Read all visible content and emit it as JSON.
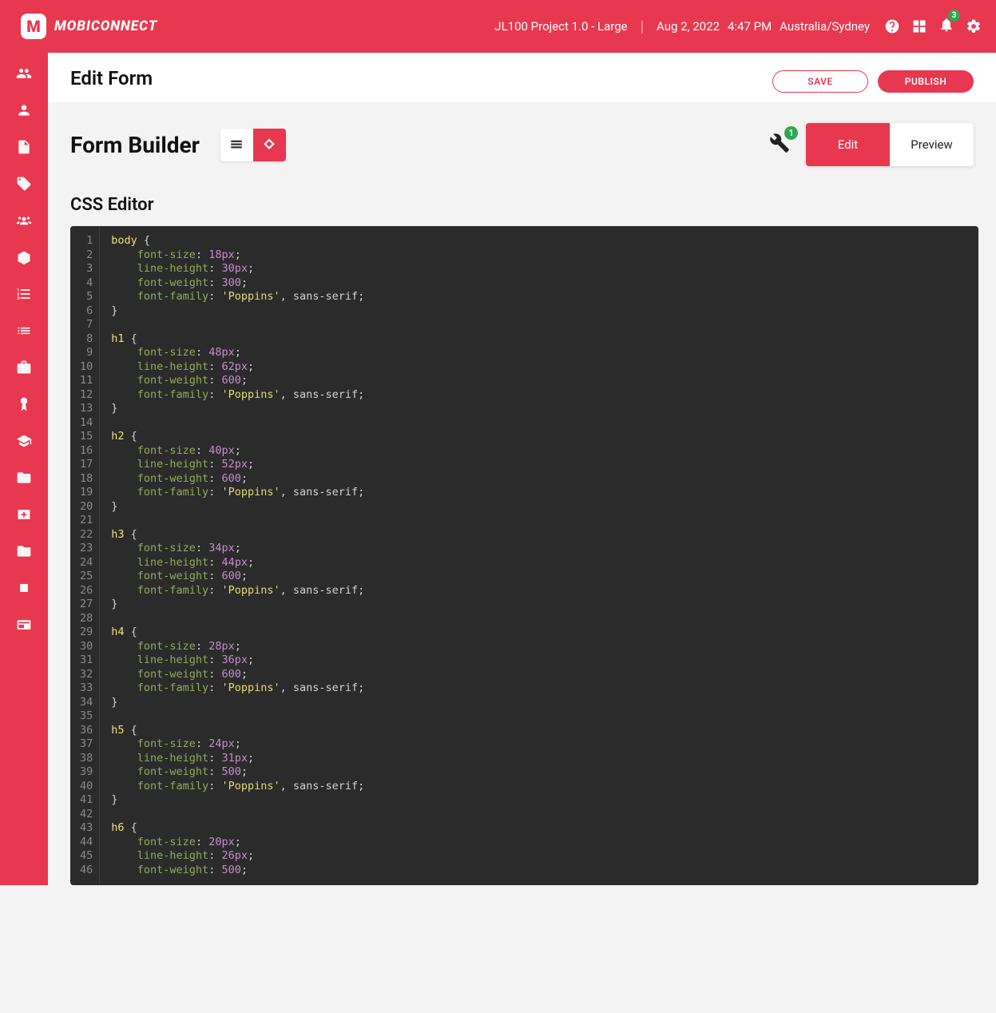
{
  "brand": "MOBICONNECT",
  "header": {
    "project": "JL100 Project 1.0 - Large",
    "date": "Aug 2, 2022",
    "time": "4:47 PM",
    "tz": "Australia/Sydney",
    "notif_count": "3"
  },
  "page": {
    "title": "Edit Form",
    "save": "SAVE",
    "publish": "PUBLISH"
  },
  "builder": {
    "title": "Form Builder",
    "wrench_badge": "1",
    "tab_edit": "Edit",
    "tab_preview": "Preview"
  },
  "css_section": {
    "title": "CSS Editor"
  },
  "code": {
    "lines": [
      [
        [
          "sel",
          "body "
        ],
        [
          "punc",
          "{"
        ]
      ],
      [
        [
          "indent",
          "    "
        ],
        [
          "prop",
          "font-size"
        ],
        [
          "punc",
          ": "
        ],
        [
          "num",
          "18px"
        ],
        [
          "punc",
          ";"
        ]
      ],
      [
        [
          "indent",
          "    "
        ],
        [
          "prop",
          "line-height"
        ],
        [
          "punc",
          ": "
        ],
        [
          "num",
          "30px"
        ],
        [
          "punc",
          ";"
        ]
      ],
      [
        [
          "indent",
          "    "
        ],
        [
          "prop",
          "font-weight"
        ],
        [
          "punc",
          ": "
        ],
        [
          "num",
          "300"
        ],
        [
          "punc",
          ";"
        ]
      ],
      [
        [
          "indent",
          "    "
        ],
        [
          "prop",
          "font-family"
        ],
        [
          "punc",
          ": "
        ],
        [
          "str",
          "'Poppins'"
        ],
        [
          "id",
          ", sans-serif"
        ],
        [
          "punc",
          ";"
        ]
      ],
      [
        [
          "punc",
          "}"
        ]
      ],
      [
        [
          "id",
          ""
        ]
      ],
      [
        [
          "sel",
          "h1 "
        ],
        [
          "punc",
          "{"
        ]
      ],
      [
        [
          "indent",
          "    "
        ],
        [
          "prop",
          "font-size"
        ],
        [
          "punc",
          ": "
        ],
        [
          "num",
          "48px"
        ],
        [
          "punc",
          ";"
        ]
      ],
      [
        [
          "indent",
          "    "
        ],
        [
          "prop",
          "line-height"
        ],
        [
          "punc",
          ": "
        ],
        [
          "num",
          "62px"
        ],
        [
          "punc",
          ";"
        ]
      ],
      [
        [
          "indent",
          "    "
        ],
        [
          "prop",
          "font-weight"
        ],
        [
          "punc",
          ": "
        ],
        [
          "num",
          "600"
        ],
        [
          "punc",
          ";"
        ]
      ],
      [
        [
          "indent",
          "    "
        ],
        [
          "prop",
          "font-family"
        ],
        [
          "punc",
          ": "
        ],
        [
          "str",
          "'Poppins'"
        ],
        [
          "id",
          ", sans-serif"
        ],
        [
          "punc",
          ";"
        ]
      ],
      [
        [
          "punc",
          "}"
        ]
      ],
      [
        [
          "id",
          ""
        ]
      ],
      [
        [
          "sel",
          "h2 "
        ],
        [
          "punc",
          "{"
        ]
      ],
      [
        [
          "indent",
          "    "
        ],
        [
          "prop",
          "font-size"
        ],
        [
          "punc",
          ": "
        ],
        [
          "num",
          "40px"
        ],
        [
          "punc",
          ";"
        ]
      ],
      [
        [
          "indent",
          "    "
        ],
        [
          "prop",
          "line-height"
        ],
        [
          "punc",
          ": "
        ],
        [
          "num",
          "52px"
        ],
        [
          "punc",
          ";"
        ]
      ],
      [
        [
          "indent",
          "    "
        ],
        [
          "prop",
          "font-weight"
        ],
        [
          "punc",
          ": "
        ],
        [
          "num",
          "600"
        ],
        [
          "punc",
          ";"
        ]
      ],
      [
        [
          "indent",
          "    "
        ],
        [
          "prop",
          "font-family"
        ],
        [
          "punc",
          ": "
        ],
        [
          "str",
          "'Poppins'"
        ],
        [
          "id",
          ", sans-serif"
        ],
        [
          "punc",
          ";"
        ]
      ],
      [
        [
          "punc",
          "}"
        ]
      ],
      [
        [
          "id",
          ""
        ]
      ],
      [
        [
          "sel",
          "h3 "
        ],
        [
          "punc",
          "{"
        ]
      ],
      [
        [
          "indent",
          "    "
        ],
        [
          "prop",
          "font-size"
        ],
        [
          "punc",
          ": "
        ],
        [
          "num",
          "34px"
        ],
        [
          "punc",
          ";"
        ]
      ],
      [
        [
          "indent",
          "    "
        ],
        [
          "prop",
          "line-height"
        ],
        [
          "punc",
          ": "
        ],
        [
          "num",
          "44px"
        ],
        [
          "punc",
          ";"
        ]
      ],
      [
        [
          "indent",
          "    "
        ],
        [
          "prop",
          "font-weight"
        ],
        [
          "punc",
          ": "
        ],
        [
          "num",
          "600"
        ],
        [
          "punc",
          ";"
        ]
      ],
      [
        [
          "indent",
          "    "
        ],
        [
          "prop",
          "font-family"
        ],
        [
          "punc",
          ": "
        ],
        [
          "str",
          "'Poppins'"
        ],
        [
          "id",
          ", sans-serif"
        ],
        [
          "punc",
          ";"
        ]
      ],
      [
        [
          "punc",
          "}"
        ]
      ],
      [
        [
          "id",
          ""
        ]
      ],
      [
        [
          "sel",
          "h4 "
        ],
        [
          "punc",
          "{"
        ]
      ],
      [
        [
          "indent",
          "    "
        ],
        [
          "prop",
          "font-size"
        ],
        [
          "punc",
          ": "
        ],
        [
          "num",
          "28px"
        ],
        [
          "punc",
          ";"
        ]
      ],
      [
        [
          "indent",
          "    "
        ],
        [
          "prop",
          "line-height"
        ],
        [
          "punc",
          ": "
        ],
        [
          "num",
          "36px"
        ],
        [
          "punc",
          ";"
        ]
      ],
      [
        [
          "indent",
          "    "
        ],
        [
          "prop",
          "font-weight"
        ],
        [
          "punc",
          ": "
        ],
        [
          "num",
          "600"
        ],
        [
          "punc",
          ";"
        ]
      ],
      [
        [
          "indent",
          "    "
        ],
        [
          "prop",
          "font-family"
        ],
        [
          "punc",
          ": "
        ],
        [
          "str",
          "'Poppins'"
        ],
        [
          "id",
          ", sans-serif"
        ],
        [
          "punc",
          ";"
        ]
      ],
      [
        [
          "punc",
          "}"
        ]
      ],
      [
        [
          "id",
          ""
        ]
      ],
      [
        [
          "sel",
          "h5 "
        ],
        [
          "punc",
          "{"
        ]
      ],
      [
        [
          "indent",
          "    "
        ],
        [
          "prop",
          "font-size"
        ],
        [
          "punc",
          ": "
        ],
        [
          "num",
          "24px"
        ],
        [
          "punc",
          ";"
        ]
      ],
      [
        [
          "indent",
          "    "
        ],
        [
          "prop",
          "line-height"
        ],
        [
          "punc",
          ": "
        ],
        [
          "num",
          "31px"
        ],
        [
          "punc",
          ";"
        ]
      ],
      [
        [
          "indent",
          "    "
        ],
        [
          "prop",
          "font-weight"
        ],
        [
          "punc",
          ": "
        ],
        [
          "num",
          "500"
        ],
        [
          "punc",
          ";"
        ]
      ],
      [
        [
          "indent",
          "    "
        ],
        [
          "prop",
          "font-family"
        ],
        [
          "punc",
          ": "
        ],
        [
          "str",
          "'Poppins'"
        ],
        [
          "id",
          ", sans-serif"
        ],
        [
          "punc",
          ";"
        ]
      ],
      [
        [
          "punc",
          "}"
        ]
      ],
      [
        [
          "id",
          ""
        ]
      ],
      [
        [
          "sel",
          "h6 "
        ],
        [
          "punc",
          "{"
        ]
      ],
      [
        [
          "indent",
          "    "
        ],
        [
          "prop",
          "font-size"
        ],
        [
          "punc",
          ": "
        ],
        [
          "num",
          "20px"
        ],
        [
          "punc",
          ";"
        ]
      ],
      [
        [
          "indent",
          "    "
        ],
        [
          "prop",
          "line-height"
        ],
        [
          "punc",
          ": "
        ],
        [
          "num",
          "26px"
        ],
        [
          "punc",
          ";"
        ]
      ],
      [
        [
          "indent",
          "    "
        ],
        [
          "prop",
          "font-weight"
        ],
        [
          "punc",
          ": "
        ],
        [
          "num",
          "500"
        ],
        [
          "punc",
          ";"
        ]
      ]
    ]
  }
}
